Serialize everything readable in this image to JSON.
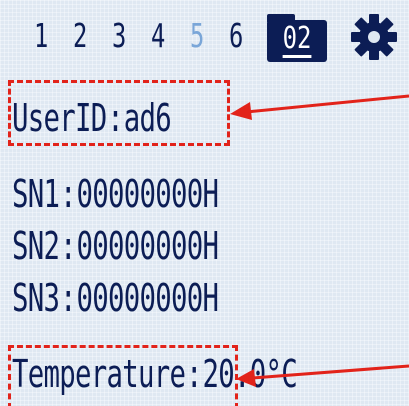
{
  "tabs": [
    {
      "label": "1",
      "active": false
    },
    {
      "label": "2",
      "active": false
    },
    {
      "label": "3",
      "active": false
    },
    {
      "label": "4",
      "active": false
    },
    {
      "label": "5",
      "active": true
    },
    {
      "label": "6",
      "active": false
    }
  ],
  "folder": {
    "label": "02",
    "icon": "folder-icon"
  },
  "settings": {
    "icon": "gear-icon"
  },
  "user": {
    "label": "UserID",
    "value": "ad6"
  },
  "serials": [
    {
      "label": "SN1",
      "value": "00000000H"
    },
    {
      "label": "SN2",
      "value": "00000000H"
    },
    {
      "label": "SN3",
      "value": "00000000H"
    }
  ],
  "temperature": {
    "label": "Temperature",
    "value": "20.0°C"
  },
  "separator": ":",
  "colors": {
    "background": "#dfe8f2",
    "text": "#0c1d55",
    "active_tab": "#7aa6d8",
    "annotation": "#e2231a"
  }
}
